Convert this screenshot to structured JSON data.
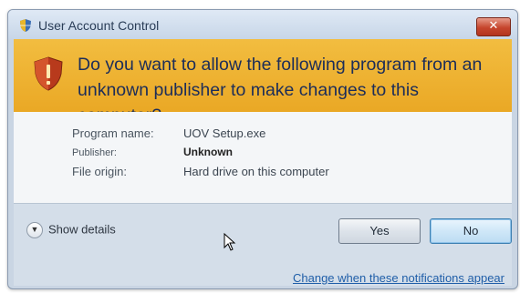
{
  "window": {
    "title": "User Account Control",
    "close_label": "✕"
  },
  "banner": {
    "question": "Do you want to allow the following program from an unknown publisher to make changes to this computer?"
  },
  "details": {
    "program_name_label": "Program name:",
    "program_name_value": "UOV Setup.exe",
    "publisher_label": "Publisher:",
    "publisher_value": "Unknown",
    "file_origin_label": "File origin:",
    "file_origin_value": "Hard drive on this computer"
  },
  "footer": {
    "show_details_label": "Show details",
    "yes_label": "Yes",
    "no_label": "No",
    "notifications_link": "Change when these notifications appear"
  },
  "icons": {
    "title_icon": "uac-shield-icon",
    "banner_icon": "warning-shield-icon",
    "details_toggle": "chevron-down-icon",
    "pointer": "mouse-cursor-icon"
  },
  "colors": {
    "banner": "#eaa825",
    "question_text": "#1c2d59",
    "link": "#1f5ea8",
    "close_button": "#c6452d"
  }
}
